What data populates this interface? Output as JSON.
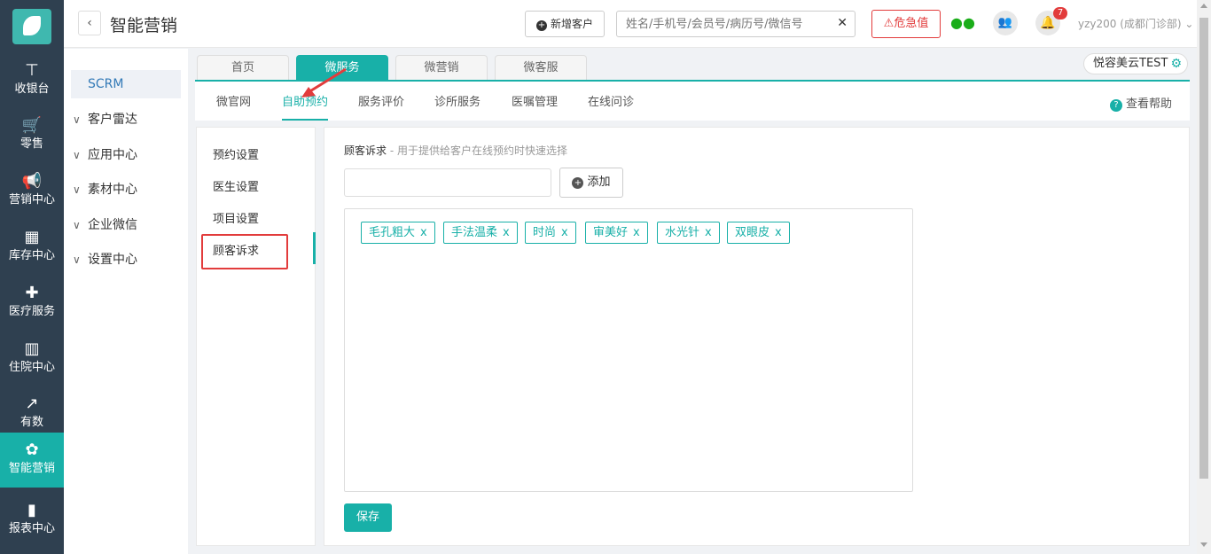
{
  "rail": {
    "items": [
      {
        "label": "收银台",
        "icon": "cash-register-icon"
      },
      {
        "label": "零售",
        "icon": "cart-icon"
      },
      {
        "label": "营销中心",
        "icon": "megaphone-icon"
      },
      {
        "label": "库存中心",
        "icon": "grid-icon"
      },
      {
        "label": "医疗服务",
        "icon": "medkit-icon"
      },
      {
        "label": "住院中心",
        "icon": "hospital-icon"
      },
      {
        "label": "有数",
        "icon": "trend-chart-icon"
      },
      {
        "label": "智能营销",
        "icon": "smart-marketing-icon"
      },
      {
        "label": "报表中心",
        "icon": "bar-chart-icon"
      }
    ],
    "active_index": 7
  },
  "header": {
    "title": "智能营销",
    "new_customer": "新增客户",
    "search_placeholder": "姓名/手机号/会员号/病历号/微信号",
    "danger_label": "危急值",
    "notification_count": "7",
    "user": "yzy200 (成都门诊部)"
  },
  "subnav": {
    "items": [
      {
        "label": "SCRM",
        "active": true
      },
      {
        "label": "客户雷达"
      },
      {
        "label": "应用中心"
      },
      {
        "label": "素材中心"
      },
      {
        "label": "企业微信"
      },
      {
        "label": "设置中心"
      }
    ]
  },
  "top_tabs": {
    "items": [
      "首页",
      "微服务",
      "微营销",
      "微客服"
    ],
    "active": "微服务"
  },
  "brand_chip": "悦容美云TEST",
  "sub_tabs": {
    "items": [
      "微官网",
      "自助预约",
      "服务评价",
      "诊所服务",
      "医嘱管理",
      "在线问诊"
    ],
    "active": "自助预约",
    "help": "查看帮助"
  },
  "inner_nav": {
    "items": [
      "预约设置",
      "医生设置",
      "项目设置",
      "顾客诉求"
    ],
    "active": "顾客诉求"
  },
  "main": {
    "section_title": "顾客诉求",
    "section_hint": " - 用于提供给客户在线预约时快速选择",
    "add_button": "添加",
    "tags": [
      "毛孔粗大",
      "手法温柔",
      "时尚",
      "审美好",
      "水光针",
      "双眼皮"
    ],
    "tag_remove": "x",
    "save_button": "保存"
  },
  "colors": {
    "accent": "#18b0a8",
    "rail_bg": "#2f4050",
    "danger": "#e23c3c"
  }
}
